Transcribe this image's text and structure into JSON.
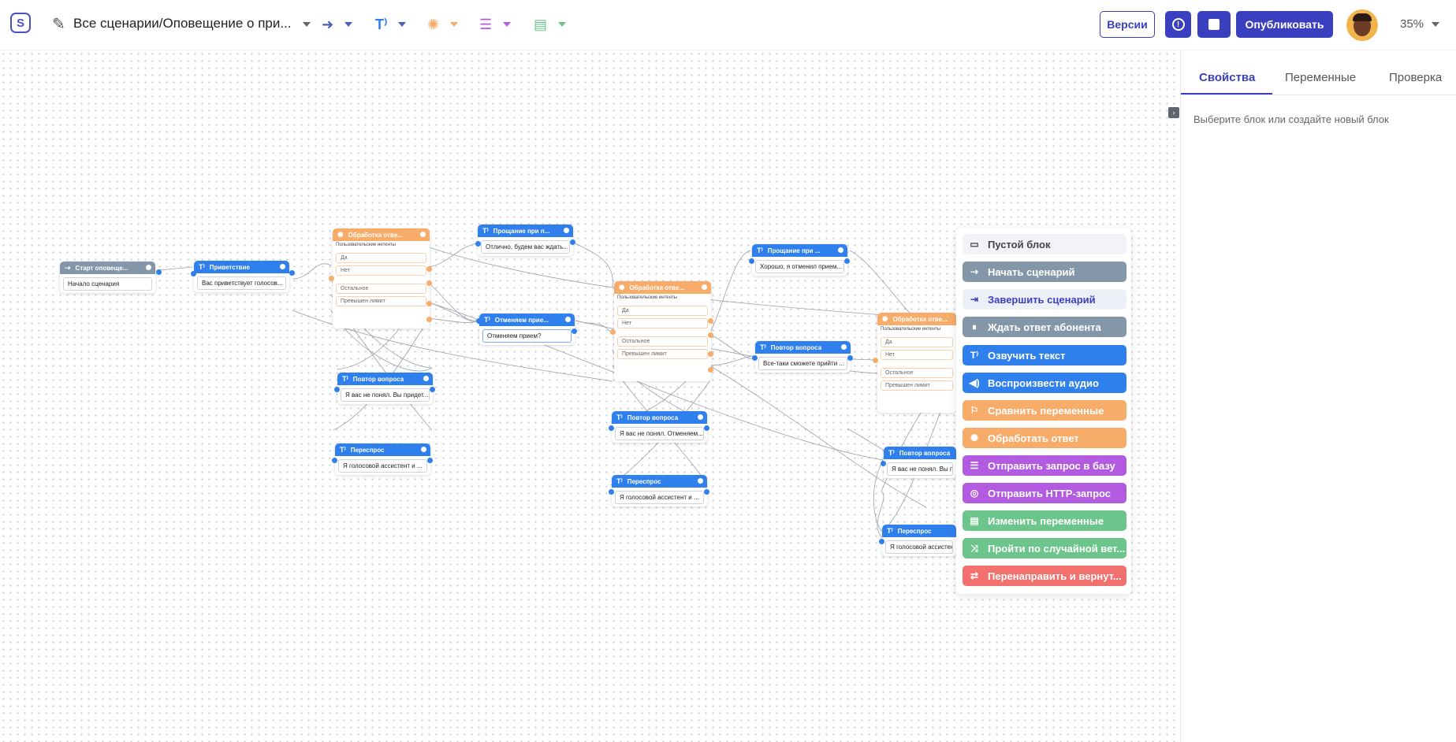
{
  "header": {
    "breadcrumb": "Все сценарии/Оповещение о при...",
    "versions_label": "Версии",
    "publish_label": "Опубликовать",
    "zoom": "35%"
  },
  "blocks": {
    "start": {
      "title": "Старт оповеще...",
      "field": "Начало сценария"
    },
    "greet": {
      "title": "Приветствие",
      "field": "Вас приветствует голосов..."
    },
    "proc1": {
      "title": "Обработка отве...",
      "sub": "Пользовательские интенты",
      "o1": "Да",
      "o2": "Нет",
      "o3": "Остальное",
      "o4": "Превышен лимит"
    },
    "bye1": {
      "title": "Прощание при п...",
      "field": "Отлично, будем вас ждать..."
    },
    "cancel": {
      "title": "Отменяем прие...",
      "field": "Отменяем прием?"
    },
    "rep1": {
      "title": "Повтор вопроса",
      "field": "Я вас не понял. Вы придет..."
    },
    "ask1": {
      "title": "Переспрос",
      "field": "Я голосовой ассистент и ..."
    },
    "proc2": {
      "title": "Обработка отве...",
      "sub": "Пользовательские интенты",
      "o1": "Да",
      "o2": "Нет",
      "o3": "Остальное",
      "o4": "Превышен лимит"
    },
    "rep2": {
      "title": "Повтор вопроса",
      "field": "Я вас не понял. Отменяем..."
    },
    "ask2": {
      "title": "Переспрос",
      "field": "Я голосовой ассистент и ..."
    },
    "bye2": {
      "title": "Прощание при ...",
      "field": "Хорошо, я отменил прием..."
    },
    "rep3": {
      "title": "Повтор вопроса",
      "field": "Все-таки сможете прийти ..."
    },
    "proc3": {
      "title": "Обработка отве...",
      "sub": "Пользовательские интенты",
      "o1": "Да",
      "o2": "Нет",
      "o3": "Остальное",
      "o4": "Превышен лимит"
    },
    "rep4": {
      "title": "Повтор вопроса",
      "field": "Я вас не понял. Вы при"
    },
    "ask3": {
      "title": "Переспрос",
      "field": "Я голосовой ассистент"
    }
  },
  "menu": {
    "empty": "Пустой блок",
    "start": "Начать сценарий",
    "finish": "Завершить сценарий",
    "wait": "Ждать ответ абонента",
    "speak": "Озвучить текст",
    "play": "Воспроизвести аудио",
    "compare": "Сравнить переменные",
    "process": "Обработать ответ",
    "db": "Отправить запрос в базу",
    "http": "Отправить HTTP-запрос",
    "vars": "Изменить переменные",
    "random": "Пройти по случайной вет...",
    "redirect": "Перенаправить и вернут..."
  },
  "colors": {
    "gray": "#8497a8",
    "blue": "#2f80ed",
    "orange": "#f7ac6a",
    "purple": "#b25be0",
    "green": "#6cc58a",
    "red": "#f2706e",
    "accent": "#3a3fbf"
  },
  "panel": {
    "tab_props": "Свойства",
    "tab_vars": "Переменные",
    "tab_check": "Проверка",
    "hint": "Выберите блок или создайте новый блок"
  }
}
